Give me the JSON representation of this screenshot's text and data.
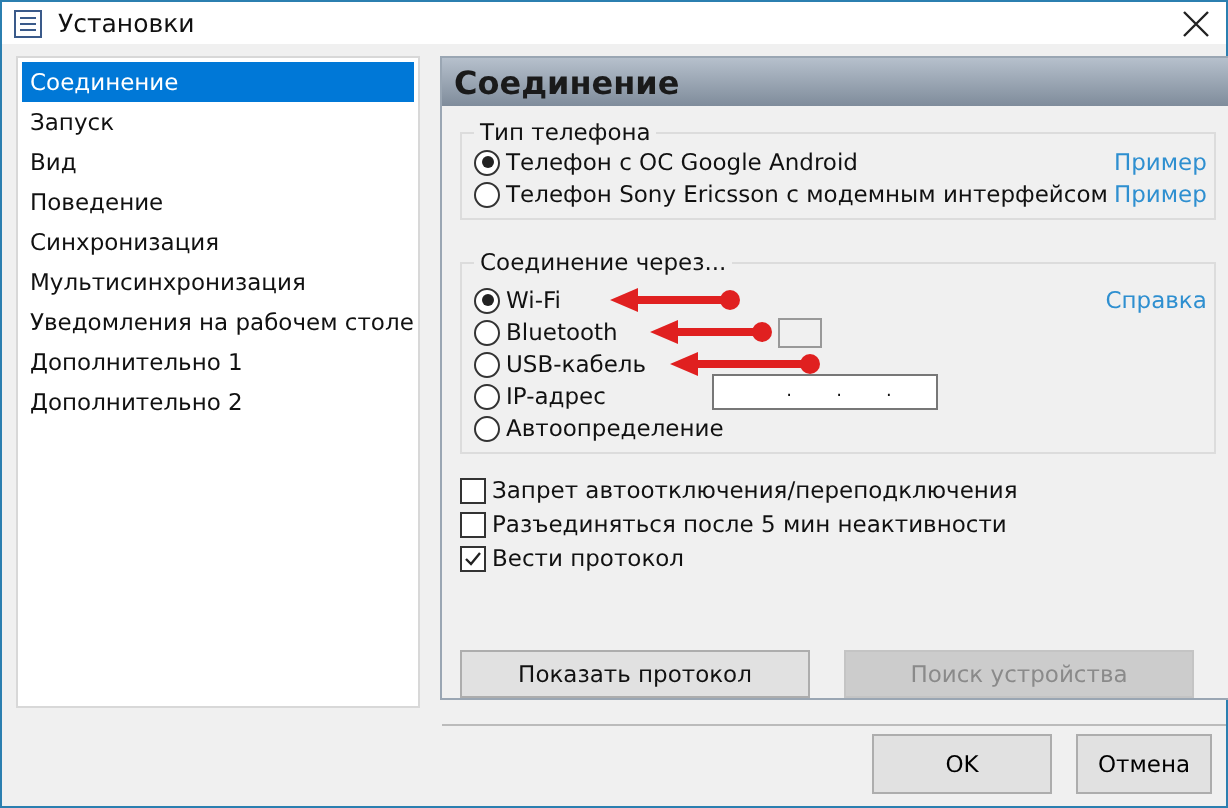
{
  "window": {
    "title": "Установки"
  },
  "sidebar": {
    "items": [
      {
        "label": "Соединение",
        "selected": true
      },
      {
        "label": "Запуск",
        "selected": false
      },
      {
        "label": "Вид",
        "selected": false
      },
      {
        "label": "Поведение",
        "selected": false
      },
      {
        "label": "Синхронизация",
        "selected": false
      },
      {
        "label": "Мультисинхронизация",
        "selected": false
      },
      {
        "label": "Уведомления на рабочем столе",
        "selected": false
      },
      {
        "label": "Дополнительно 1",
        "selected": false
      },
      {
        "label": "Дополнительно 2",
        "selected": false
      }
    ]
  },
  "panel": {
    "title": "Соединение",
    "phone_type": {
      "legend": "Тип телефона",
      "options": [
        {
          "label": "Телефон с ОС Google Android",
          "selected": true,
          "link": "Пример"
        },
        {
          "label": "Телефон Sony Ericsson с модемным интерфейсом",
          "selected": false,
          "link": "Пример"
        }
      ]
    },
    "connection": {
      "legend": "Соединение через...",
      "link": "Справка",
      "options": [
        {
          "label": "Wi-Fi",
          "selected": true,
          "kind": "plain",
          "arrowed": true
        },
        {
          "label": "Bluetooth",
          "selected": false,
          "kind": "box",
          "arrowed": true
        },
        {
          "label": "USB-кабель",
          "selected": false,
          "kind": "plain",
          "arrowed": true
        },
        {
          "label": "IP-адрес",
          "selected": false,
          "kind": "ip",
          "separators": [
            ".",
            ".",
            "."
          ],
          "arrowed": false
        },
        {
          "label": "Автоопределение",
          "selected": false,
          "kind": "plain",
          "arrowed": false
        }
      ]
    },
    "checkboxes": [
      {
        "label": "Запрет автоотключения/переподключения",
        "checked": false
      },
      {
        "label": "Разъединяться после 5 мин неактивности",
        "checked": false
      },
      {
        "label": "Вести протокол",
        "checked": true
      }
    ],
    "buttons": [
      {
        "label": "Показать протокол",
        "disabled": false
      },
      {
        "label": "Поиск устройства",
        "disabled": true
      }
    ]
  },
  "buttons": [
    "OK",
    "Отмена"
  ]
}
